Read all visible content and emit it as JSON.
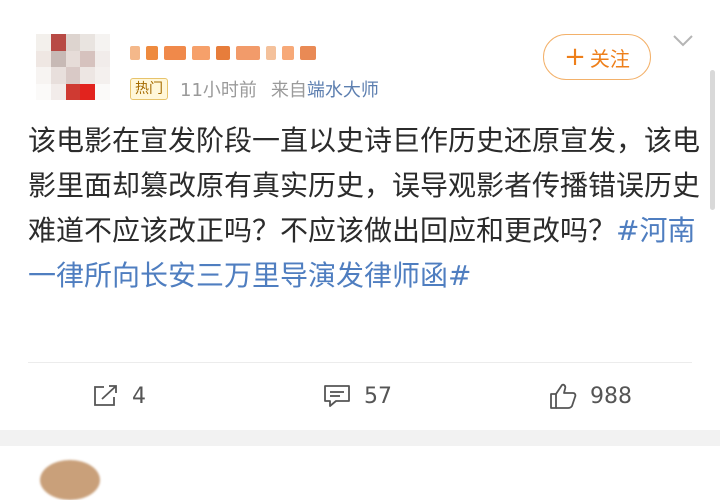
{
  "post": {
    "hot_badge": "热门",
    "time": "11小时前",
    "from_prefix": "来自",
    "source": "端水大师",
    "follow_label": "关注",
    "follow_plus": "+",
    "content_text": "该电影在宣发阶段一直以史诗巨作历史还原宣发，该电影里面却篡改原有真实历史，误导观影者传播错误历史难道不应该改正吗？不应该做出回应和更改吗？",
    "hashtag": "#河南一律所向长安三万里导演发律师函#"
  },
  "actions": {
    "repost_count": "4",
    "comment_count": "57",
    "like_count": "988"
  },
  "colors": {
    "accent_orange": "#ee7f1a",
    "link_blue": "#4f7ec0"
  },
  "icons": [
    "chevron-down-icon",
    "repost-icon",
    "comment-icon",
    "like-icon"
  ]
}
